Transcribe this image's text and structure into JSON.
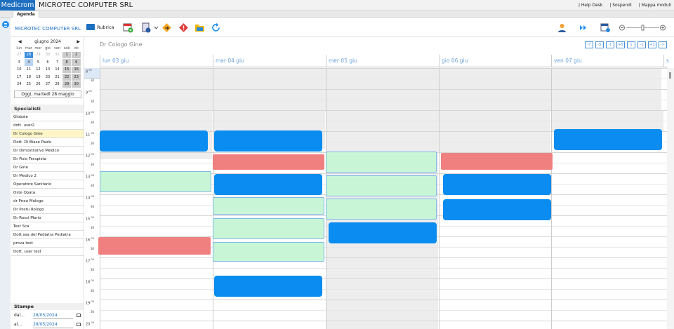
{
  "app": {
    "brand": "Medicrom",
    "company": "MICROTEC COMPUTER SRL",
    "links": [
      "| Help Desk",
      "| Sospendi",
      "| Mappa moduli"
    ],
    "tab": "Agenda"
  },
  "toolbar": {
    "company": "MICROTEC COMPUTER SRL",
    "rubrica": "Rubrica"
  },
  "calendar": {
    "month_label": "giugno 2024",
    "weekdays": [
      "lun",
      "mar",
      "mer",
      "gio",
      "ven",
      "sab",
      "do"
    ],
    "weeks": [
      [
        "27",
        "28",
        "29",
        "30",
        "31",
        "1",
        "2"
      ],
      [
        "3",
        "4",
        "5",
        "6",
        "7",
        "8",
        "9"
      ],
      [
        "10",
        "11",
        "12",
        "13",
        "14",
        "15",
        "16"
      ],
      [
        "17",
        "18",
        "19",
        "20",
        "21",
        "22",
        "23"
      ],
      [
        "24",
        "25",
        "26",
        "27",
        "28",
        "29",
        "30"
      ]
    ],
    "today_button": "Oggi, martedì 28 maggio"
  },
  "specialists": {
    "title": "Specialisti",
    "items": [
      "Globale",
      "dott. user2",
      "Dr Cologo Gine",
      "Dott. Di Biase Paolo",
      "Dr Dimostrativo Medico",
      "Dr Fisio Terapista",
      "Dr Gine",
      "Dr Medico 2",
      "Operatore Sanitario",
      "Oste Opata",
      "dr Pneu Mologo",
      "Dr Postu Rologo",
      "Dr Rossi Mario",
      "Test Sca",
      "Dott.ssa del Pediatra Pediatra",
      "prova test",
      "Dott. user test"
    ],
    "active": "Dr Cologo Gine"
  },
  "stampe": {
    "title": "Stampe",
    "dal_label": "dal...",
    "al_label": "al...",
    "dal": "28/05/2024",
    "al": "28/05/2024"
  },
  "agenda": {
    "doctor": "Dr Cologo Gine",
    "days": [
      "lun 03 giu",
      "mar 04 giu",
      "mer 05 giu",
      "gio 06 giu",
      "ven 07 giu",
      "s"
    ],
    "nav": [
      "-7",
      "-5",
      "-1",
      "+5",
      "1",
      "-1",
      "+1",
      "->"
    ],
    "hours": [
      "8",
      "9",
      "10",
      "11",
      "12",
      "13",
      "14",
      "15",
      "16",
      "17",
      "18",
      "19",
      "20"
    ],
    "minutes_label": "00",
    "half_label": "30"
  },
  "colors": {
    "brand": "#1e6fc0",
    "booked": "#0a8cf0",
    "blocked": "#f08080",
    "free": "#c8f5d6"
  }
}
